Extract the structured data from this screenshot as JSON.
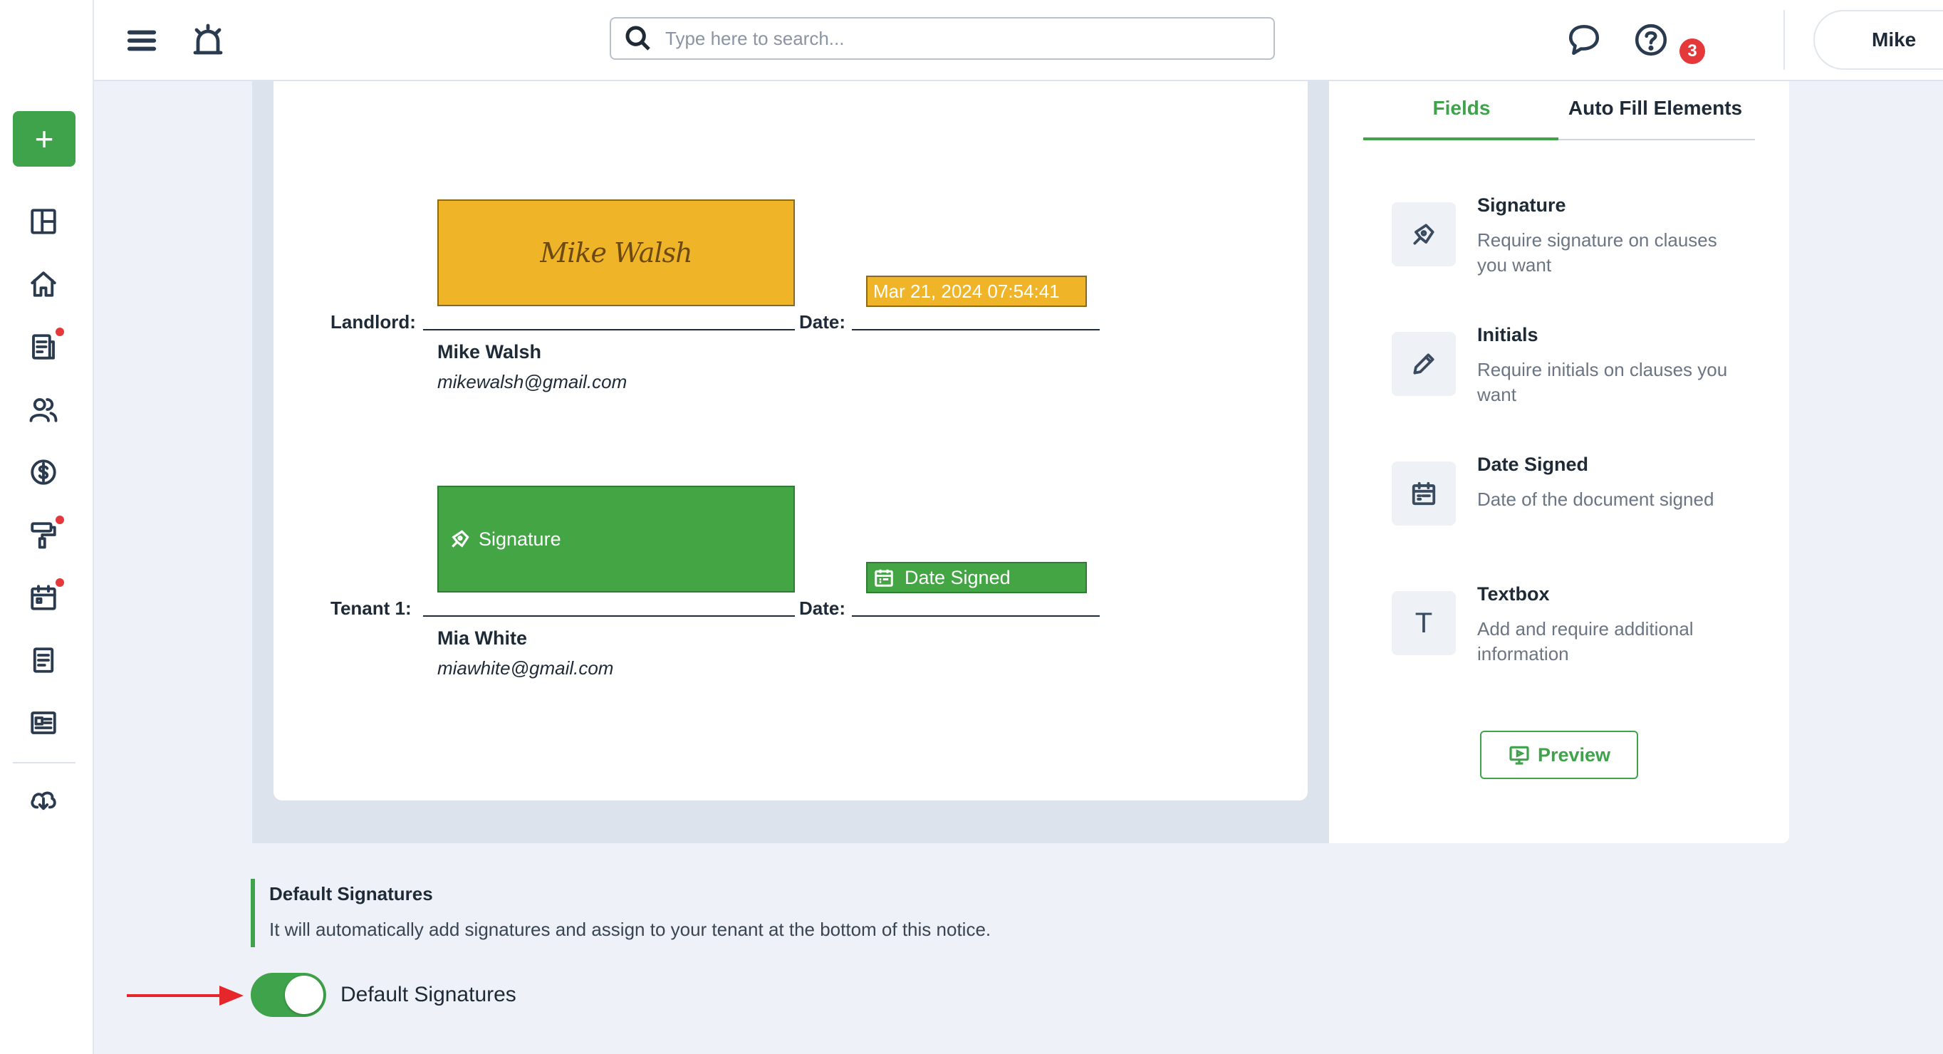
{
  "topbar": {
    "search_placeholder": "Type here to search...",
    "notification_count": "3",
    "user_name": "Mike"
  },
  "document": {
    "landlord": {
      "role_label": "Landlord:",
      "date_label": "Date:",
      "signature_text": "Mike Walsh",
      "date_value": "Mar 21, 2024 07:54:41",
      "name": "Mike Walsh",
      "email": "mikewalsh@gmail.com"
    },
    "tenant": {
      "role_label": "Tenant 1:",
      "date_label": "Date:",
      "signature_placeholder": "Signature",
      "date_placeholder": "Date Signed",
      "name": "Mia White",
      "email": "miawhite@gmail.com"
    }
  },
  "panel": {
    "tabs": [
      {
        "label": "Fields",
        "active": true
      },
      {
        "label": "Auto Fill Elements",
        "active": false
      }
    ],
    "fields": [
      {
        "title": "Signature",
        "description": "Require signature on clauses you want",
        "icon": "pen-nib-icon"
      },
      {
        "title": "Initials",
        "description": "Require initials on clauses you want",
        "icon": "pencil-icon"
      },
      {
        "title": "Date Signed",
        "description": "Date of the document signed",
        "icon": "calendar-icon"
      },
      {
        "title": "Textbox",
        "description": "Add and require additional information",
        "icon": "text-icon"
      }
    ],
    "preview_label": "Preview"
  },
  "default_signatures": {
    "title": "Default Signatures",
    "description": "It will automatically add signatures and assign to your tenant at the bottom of this notice.",
    "toggle_label": "Default Signatures",
    "toggle_on": true
  },
  "colors": {
    "accent_green": "#3ea34a",
    "signed_yellow": "#f0b429",
    "badge_red": "#e5383b"
  }
}
